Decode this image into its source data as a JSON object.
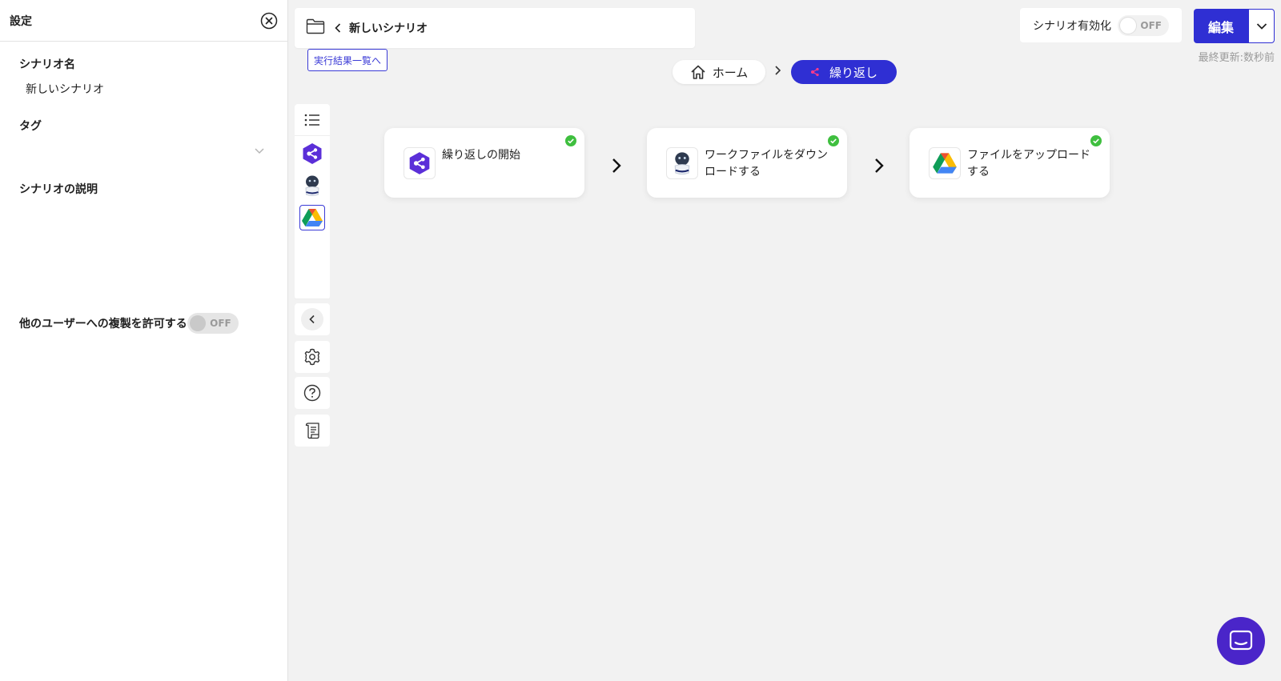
{
  "settings": {
    "title": "設定",
    "scenario_name_label": "シナリオ名",
    "scenario_name_value": "新しいシナリオ",
    "tag_label": "タグ",
    "description_label": "シナリオの説明",
    "allow_copy_label": "他のユーザーへの複製を許可する",
    "allow_copy_toggle": "OFF"
  },
  "header": {
    "scenario_title": "新しいシナリオ",
    "results_link": "実行結果一覧へ",
    "enable_label": "シナリオ有効化",
    "enable_toggle": "OFF",
    "edit_label": "編集",
    "last_updated": "最終更新:数秒前"
  },
  "breadcrumb": {
    "home": "ホーム",
    "current": "繰り返し"
  },
  "steps": [
    {
      "label": "繰り返しの開始",
      "icon": "loop-start-icon",
      "status": "done"
    },
    {
      "label": "ワークファイルをダウンロードする",
      "icon": "robot-icon",
      "status": "done"
    },
    {
      "label": "ファイルをアップロードする",
      "icon": "google-drive-icon",
      "status": "done"
    }
  ],
  "colors": {
    "accent": "#2f2fd3",
    "success": "#3fbf3f",
    "chat": "#4a25c9"
  }
}
